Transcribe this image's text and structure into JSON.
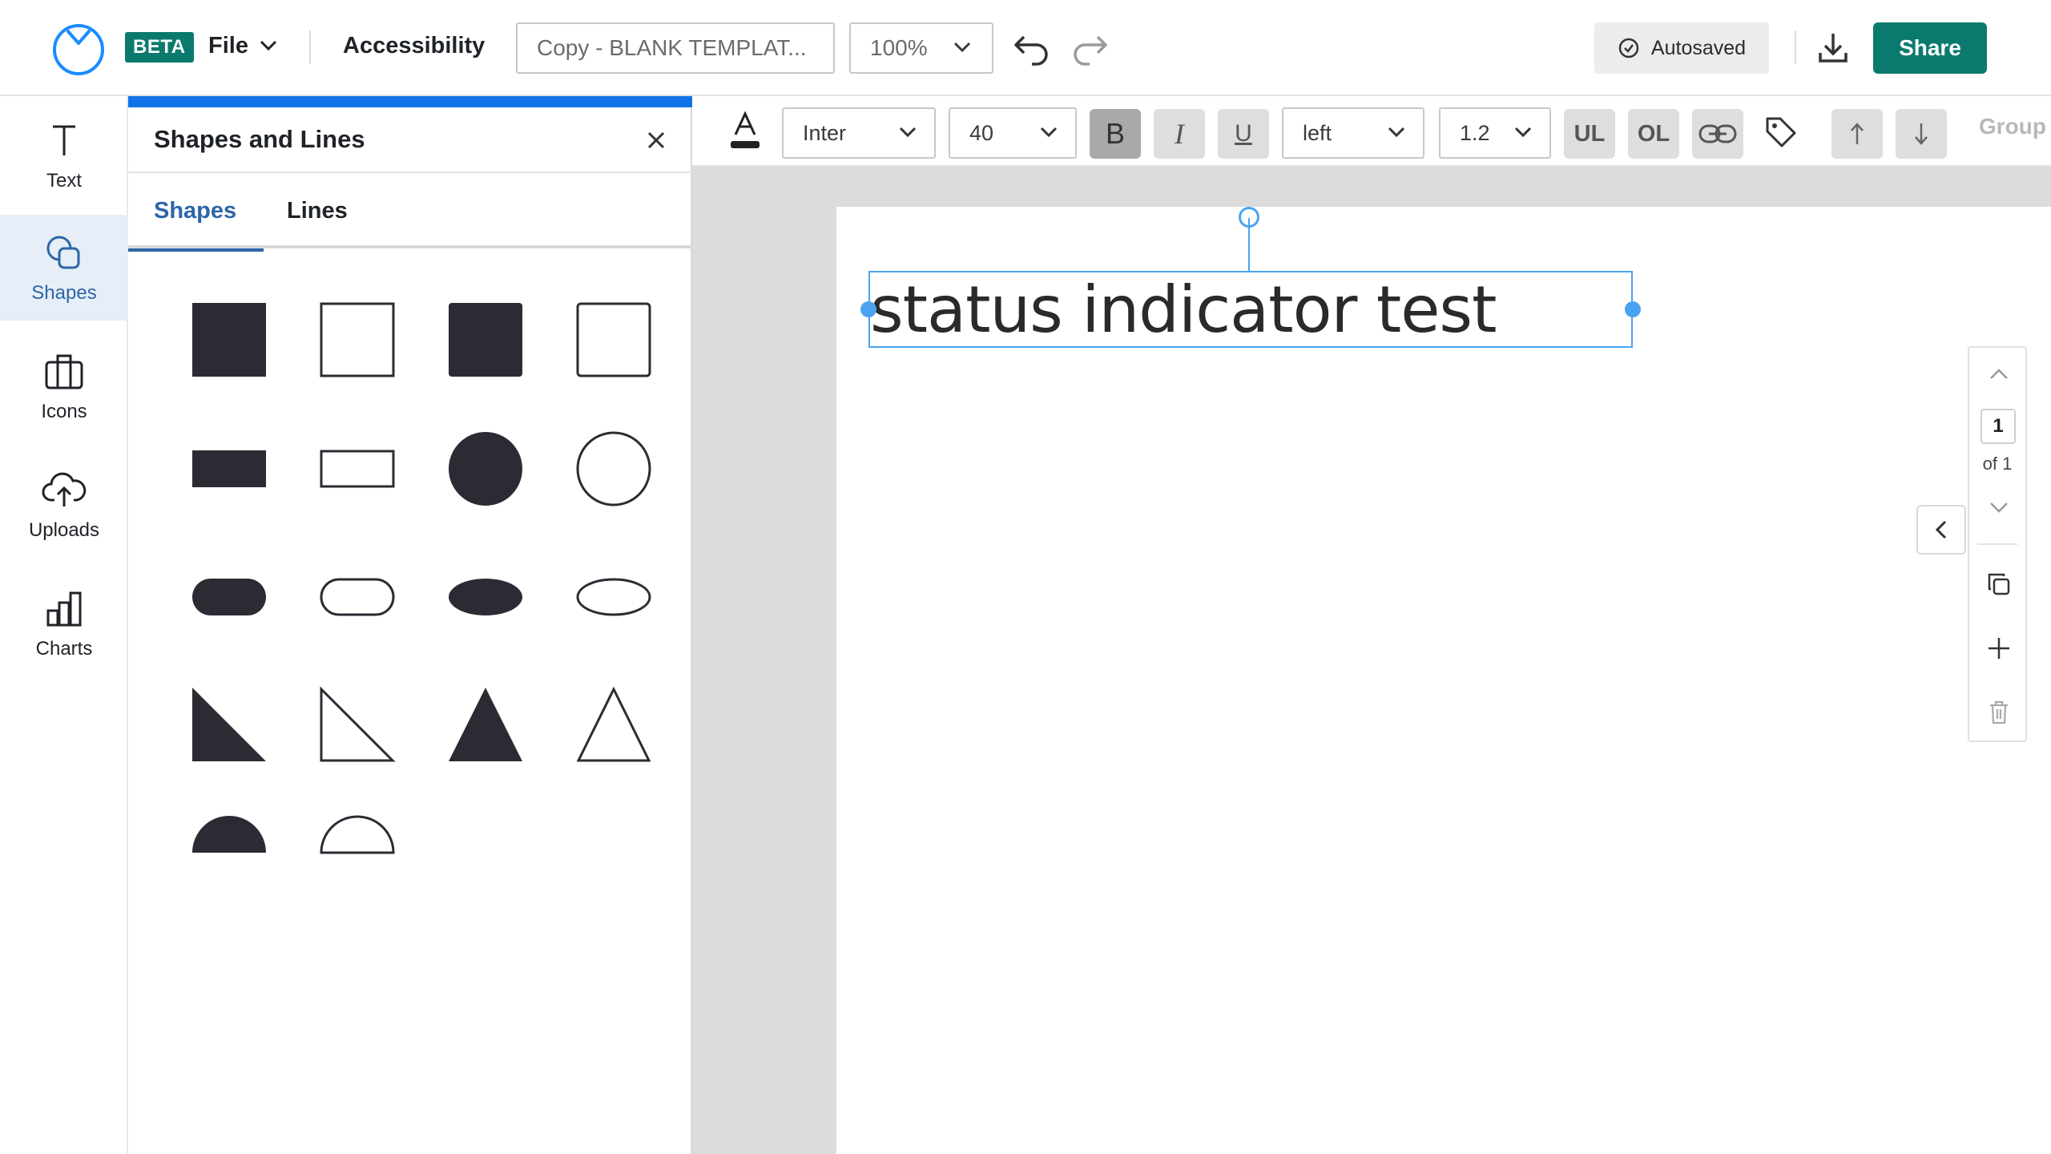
{
  "header": {
    "beta_label": "BETA",
    "file_label": "File",
    "accessibility_label": "Accessibility",
    "document_name": "Copy - BLANK TEMPLAT...",
    "zoom_value": "100%",
    "autosaved_label": "Autosaved",
    "share_label": "Share",
    "brand_color": "#0b7a6e"
  },
  "rail": {
    "items": [
      {
        "label": "Text",
        "icon": "text-icon"
      },
      {
        "label": "Shapes",
        "icon": "shapes-icon",
        "active": true
      },
      {
        "label": "Icons",
        "icon": "briefcase-icon"
      },
      {
        "label": "Uploads",
        "icon": "upload-cloud-icon"
      },
      {
        "label": "Charts",
        "icon": "bar-chart-icon"
      }
    ]
  },
  "panel": {
    "title": "Shapes and Lines",
    "tabs": [
      {
        "label": "Shapes",
        "active": true
      },
      {
        "label": "Lines",
        "active": false
      }
    ],
    "shapes": [
      "filled-square",
      "outline-square",
      "filled-square",
      "outline-square",
      "filled-rectangle",
      "outline-rectangle",
      "filled-circle",
      "outline-circle",
      "filled-pill",
      "outline-pill",
      "filled-ellipse",
      "outline-ellipse",
      "filled-right-triangle",
      "outline-right-triangle",
      "filled-triangle",
      "outline-triangle",
      "filled-semicircle",
      "outline-semicircle"
    ]
  },
  "format_toolbar": {
    "font_family": "Inter",
    "font_size": "40",
    "bold_label": "B",
    "italic_label": "I",
    "underline_label": "U",
    "alignment": "left",
    "line_height": "1.2",
    "ul_label": "UL",
    "ol_label": "OL",
    "group_label": "Group"
  },
  "canvas": {
    "text_content": "status indicator test",
    "selection_color": "#4aa3f0"
  },
  "page_nav": {
    "current_page": "1",
    "of_label": "of 1"
  }
}
